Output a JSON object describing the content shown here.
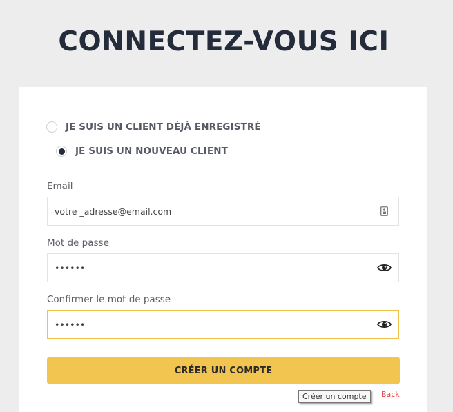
{
  "header": {
    "title": "CONNECTEZ-VOUS ICI"
  },
  "account_type": {
    "options": [
      {
        "label": "JE SUIS UN CLIENT DÉJÀ ENREGISTRÉ",
        "selected": false
      },
      {
        "label": "JE SUIS UN NOUVEAU CLIENT",
        "selected": true
      }
    ]
  },
  "form": {
    "email": {
      "label": "Email",
      "value": "votre _adresse@email.com",
      "icon": "contact-card-icon"
    },
    "password": {
      "label": "Mot de passe",
      "value": "••••••",
      "icon": "eye-icon"
    },
    "confirm_password": {
      "label": "Confirmer le mot de passe",
      "value": "••••••",
      "icon": "eye-icon"
    },
    "submit_label": "CRÉER UN COMPTE",
    "submit_tooltip": "Créer un compte"
  },
  "links": {
    "back": "Back"
  },
  "colors": {
    "background": "#ededed",
    "card": "#ffffff",
    "title": "#242b3a",
    "accent": "#f2c450",
    "link": "#e0474c"
  }
}
